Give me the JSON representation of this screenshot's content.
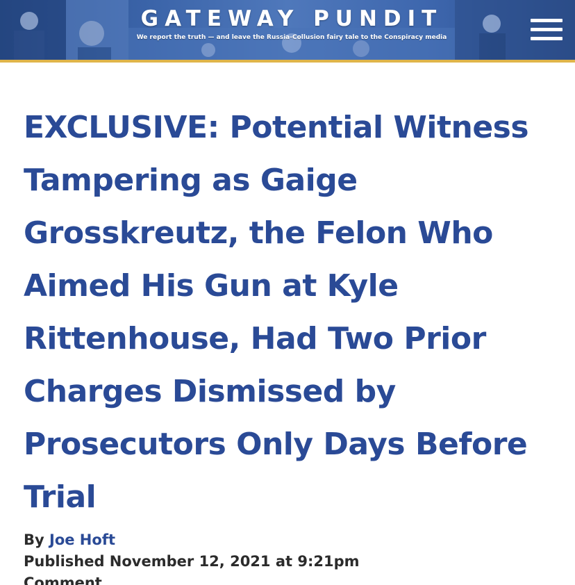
{
  "header": {
    "brand_title": "GATEWAY PUNDIT",
    "tagline": "We report the truth — and leave the Russia-Collusion fairy tale to the Conspiracy media",
    "menu_icon": "hamburger-menu-icon"
  },
  "article": {
    "title": "EXCLUSIVE: Potential Witness Tampering as Gaige Grosskreutz, the Felon Who Aimed His Gun at Kyle Rittenhouse, Had Two Prior Charges Dismissed by Prosecutors Only Days Before Trial",
    "byline_prefix": "By",
    "author": "Joe Hoft",
    "published": "Published November 12, 2021 at 9:21pm",
    "comment_label": "Comment"
  },
  "colors": {
    "header_blue": "#3a63a8",
    "header_accent": "#e0b54a",
    "title_blue": "#2a4a96",
    "text_dark": "#2b2b2b"
  }
}
